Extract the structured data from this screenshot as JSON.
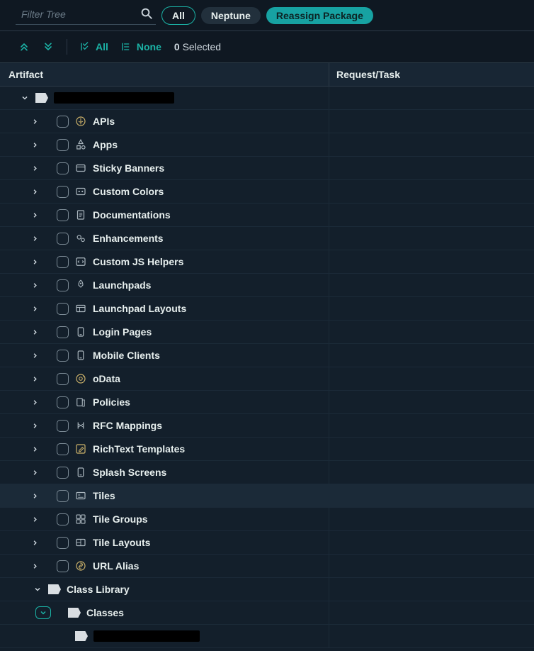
{
  "search": {
    "placeholder": "Filter Tree"
  },
  "topbar": {
    "all": "All",
    "neptune": "Neptune",
    "reassign": "Reassign Package"
  },
  "secbar": {
    "select_all": "All",
    "select_none": "None",
    "selected_count": "0",
    "selected_word": "Selected"
  },
  "columns": {
    "artifact": "Artifact",
    "task": "Request/Task"
  },
  "tree": {
    "root_redacted_width": 170,
    "items": [
      {
        "id": "apis",
        "label": "APIs",
        "icon": "api",
        "color": "gold"
      },
      {
        "id": "apps",
        "label": "Apps",
        "icon": "apps",
        "color": "grey"
      },
      {
        "id": "sticky",
        "label": "Sticky Banners",
        "icon": "banner",
        "color": "grey"
      },
      {
        "id": "colors",
        "label": "Custom Colors",
        "icon": "palette",
        "color": "grey"
      },
      {
        "id": "docs",
        "label": "Documentations",
        "icon": "doc",
        "color": "grey"
      },
      {
        "id": "enh",
        "label": "Enhancements",
        "icon": "gears",
        "color": "grey"
      },
      {
        "id": "jshelpers",
        "label": "Custom JS Helpers",
        "icon": "code",
        "color": "grey"
      },
      {
        "id": "launchpads",
        "label": "Launchpads",
        "icon": "rocket",
        "color": "grey"
      },
      {
        "id": "lplayouts",
        "label": "Launchpad Layouts",
        "icon": "layout",
        "color": "grey"
      },
      {
        "id": "login",
        "label": "Login Pages",
        "icon": "device",
        "color": "grey"
      },
      {
        "id": "mobile",
        "label": "Mobile Clients",
        "icon": "device",
        "color": "grey"
      },
      {
        "id": "odata",
        "label": "oData",
        "icon": "odata",
        "color": "gold"
      },
      {
        "id": "policies",
        "label": "Policies",
        "icon": "policy",
        "color": "grey"
      },
      {
        "id": "rfc",
        "label": "RFC Mappings",
        "icon": "mapping",
        "color": "grey"
      },
      {
        "id": "richtext",
        "label": "RichText Templates",
        "icon": "edit",
        "color": "gold"
      },
      {
        "id": "splash",
        "label": "Splash Screens",
        "icon": "device",
        "color": "grey"
      },
      {
        "id": "tiles",
        "label": "Tiles",
        "icon": "tile",
        "color": "grey",
        "highlighted": true
      },
      {
        "id": "tilegroups",
        "label": "Tile Groups",
        "icon": "tilegroup",
        "color": "grey"
      },
      {
        "id": "tilelayouts",
        "label": "Tile Layouts",
        "icon": "tilelayout",
        "color": "grey"
      },
      {
        "id": "urlalias",
        "label": "URL Alias",
        "icon": "link",
        "color": "gold"
      }
    ],
    "class_library": {
      "label": "Class Library",
      "classes_label": "Classes",
      "leaf_redacted_width": 150
    }
  }
}
